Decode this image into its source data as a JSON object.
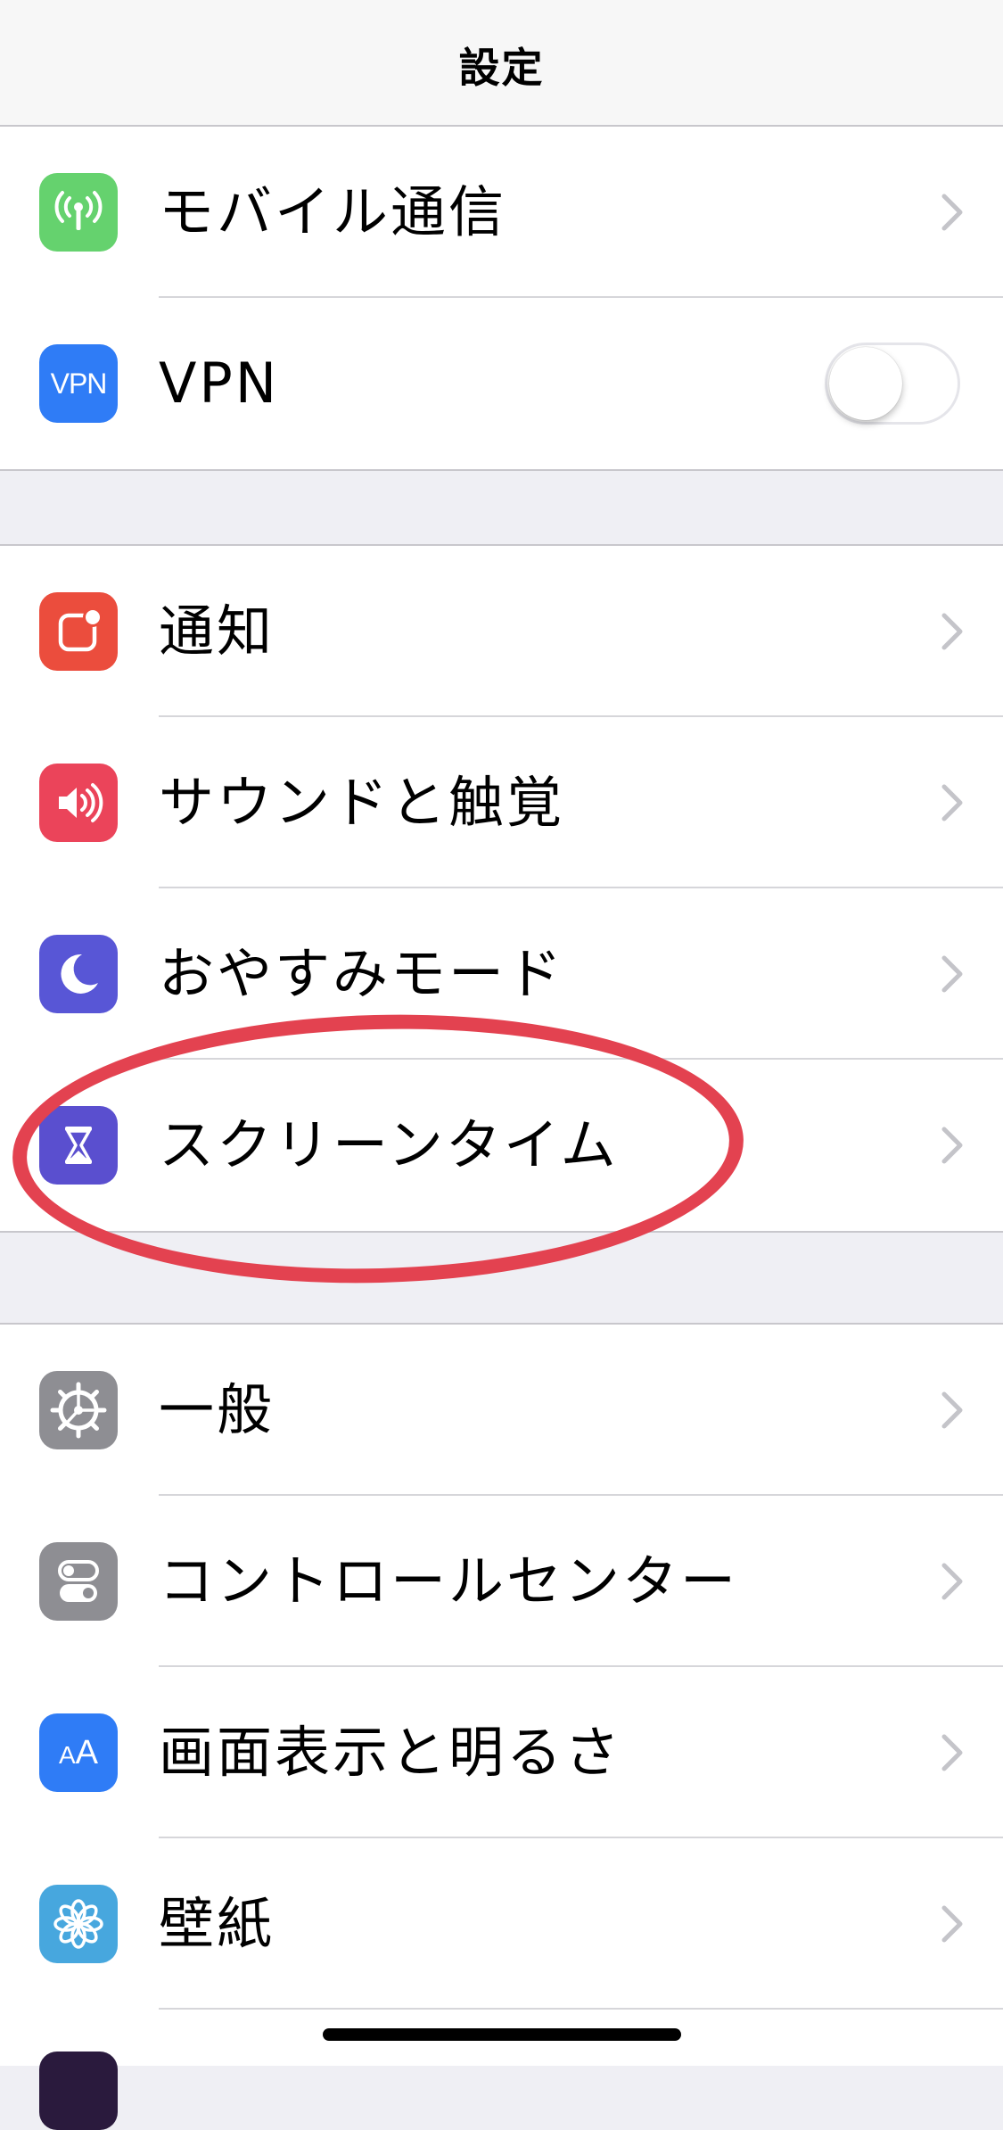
{
  "nav": {
    "title": "設定"
  },
  "colors": {
    "cellular": "#65d26e",
    "vpn": "#2f7cf6",
    "notifications": "#eb4d3d",
    "sounds": "#eb445a",
    "dnd": "#5856d6",
    "screen_time": "#5a4fcf",
    "general": "#8e8e93",
    "control_center": "#8e8e93",
    "display": "#2f7cf6",
    "wallpaper": "#47a7de",
    "annotation": "#e34250"
  },
  "groups": {
    "connectivity": [
      {
        "label": "モバイル通信",
        "icon": "antenna-icon",
        "accessory": "chevron"
      },
      {
        "label": "VPN",
        "icon": "vpn-icon",
        "icon_text": "VPN",
        "accessory": "toggle",
        "toggle_on": false
      }
    ],
    "alerts": [
      {
        "label": "通知",
        "icon": "notifications-icon",
        "accessory": "chevron"
      },
      {
        "label": "サウンドと触覚",
        "icon": "speaker-icon",
        "accessory": "chevron"
      },
      {
        "label": "おやすみモード",
        "icon": "moon-icon",
        "accessory": "chevron"
      },
      {
        "label": "スクリーンタイム",
        "icon": "hourglass-icon",
        "accessory": "chevron"
      }
    ],
    "system": [
      {
        "label": "一般",
        "icon": "gear-icon",
        "accessory": "chevron"
      },
      {
        "label": "コントロールセンター",
        "icon": "switches-icon",
        "accessory": "chevron"
      },
      {
        "label": "画面表示と明るさ",
        "icon": "text-size-icon",
        "icon_text": "AA",
        "accessory": "chevron"
      },
      {
        "label": "壁紙",
        "icon": "flower-icon",
        "accessory": "chevron"
      }
    ]
  },
  "annotation": {
    "shape": "red-ellipse",
    "target": "スクリーンタイム"
  }
}
